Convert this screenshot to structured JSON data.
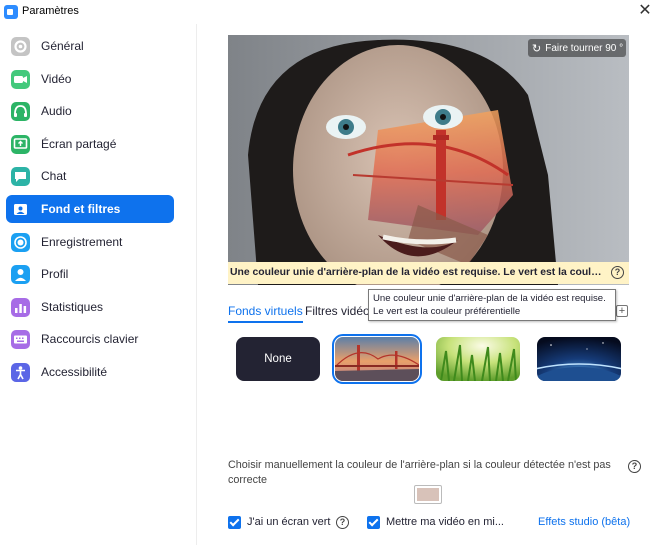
{
  "window": {
    "title": "Paramètres",
    "close_glyph": "✕",
    "app_icon": "zoom-camera-icon",
    "accent_color": "#0e72ed"
  },
  "sidebar": {
    "items": [
      {
        "label": "Général",
        "icon": "gear-icon",
        "color": "#c4c4c4",
        "active": false
      },
      {
        "label": "Vidéo",
        "icon": "video-camera-icon",
        "color": "#43c97c",
        "active": false
      },
      {
        "label": "Audio",
        "icon": "headphones-icon",
        "color": "#2cb466",
        "active": false
      },
      {
        "label": "Écran partagé",
        "icon": "share-screen-icon",
        "color": "#2cb466",
        "active": false
      },
      {
        "label": "Chat",
        "icon": "chat-bubble-icon",
        "color": "#2cb3a6",
        "active": false
      },
      {
        "label": "Fond et filtres",
        "icon": "background-portrait-icon",
        "color": "#ffffff",
        "active": true
      },
      {
        "label": "Enregistrement",
        "icon": "record-icon",
        "color": "#1ba0f2",
        "active": false
      },
      {
        "label": "Profil",
        "icon": "profile-icon",
        "color": "#1ba0f2",
        "active": false
      },
      {
        "label": "Statistiques",
        "icon": "statistics-icon",
        "color": "#a76ce6",
        "active": false
      },
      {
        "label": "Raccourcis clavier",
        "icon": "keyboard-icon",
        "color": "#a76ce6",
        "active": false
      },
      {
        "label": "Accessibilité",
        "icon": "accessibility-icon",
        "color": "#5b66e6",
        "active": false
      }
    ]
  },
  "preview": {
    "rotate_label": "Faire tourner 90 °",
    "rotate_icon": "rotate-icon",
    "warning": "Une couleur unie d'arrière-plan de la vidéo est requise. Le vert est la couleur pr...",
    "warning_bg": "#fff3c6"
  },
  "tooltip": {
    "line1": "Une couleur unie d'arrière-plan de la vidéo est requise.",
    "line2": "Le vert est la couleur préférentielle"
  },
  "tabs": [
    {
      "label": "Fonds virtuels",
      "active": true
    },
    {
      "label": "Filtres vidéo",
      "active": false
    }
  ],
  "add_label": "+",
  "backgrounds": [
    {
      "label": "None",
      "kind": "none",
      "selected": false
    },
    {
      "kind": "golden-gate-bridge",
      "selected": true
    },
    {
      "kind": "grass",
      "selected": false
    },
    {
      "kind": "earth-from-space",
      "selected": false
    }
  ],
  "manual_color": {
    "text": "Choisir manuellement la couleur de l'arrière-plan si la couleur détectée n'est pas correcte",
    "swatch": "#d8c2b9"
  },
  "options": {
    "green_screen_label": "J'ai un écran vert",
    "green_screen_checked": true,
    "mirror_label": "Mettre ma vidéo en mi...",
    "mirror_checked": true,
    "studio_link": "Effets studio (bêta)"
  },
  "help_glyph": "?"
}
